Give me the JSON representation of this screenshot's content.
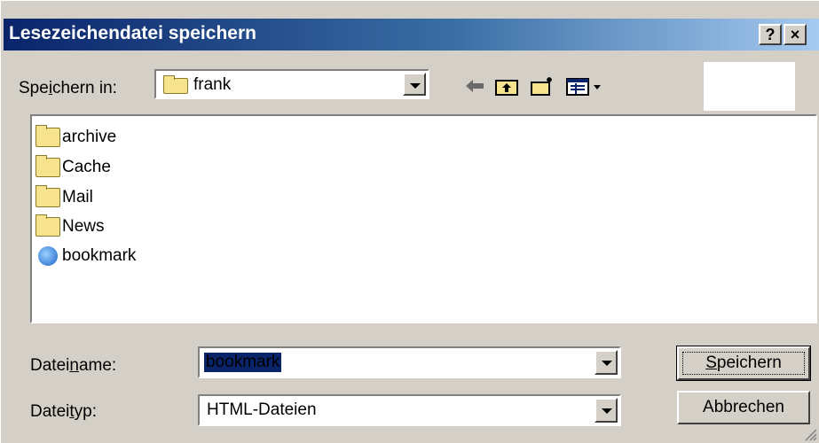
{
  "window": {
    "title": "Lesezeichendatei speichern",
    "help_label": "?",
    "close_label": "×"
  },
  "save_in": {
    "label_pre": "Spe",
    "label_ul": "i",
    "label_post": "chern in:",
    "value": "frank"
  },
  "files": [
    {
      "name": "archive",
      "icon": "folder-icon"
    },
    {
      "name": "Cache",
      "icon": "folder-icon"
    },
    {
      "name": "Mail",
      "icon": "folder-icon"
    },
    {
      "name": "News",
      "icon": "folder-icon"
    },
    {
      "name": "bookmark",
      "icon": "ie-html-file-icon"
    }
  ],
  "filename": {
    "label_pre": "Datei",
    "label_ul": "n",
    "label_post": "ame:",
    "value": "bookmark"
  },
  "filetype": {
    "label_pre": "Datei",
    "label_ul": "t",
    "label_post": "yp:",
    "value": "HTML-Dateien"
  },
  "buttons": {
    "save_ul": "S",
    "save_rest": "peichern",
    "cancel": "Abbrechen"
  }
}
